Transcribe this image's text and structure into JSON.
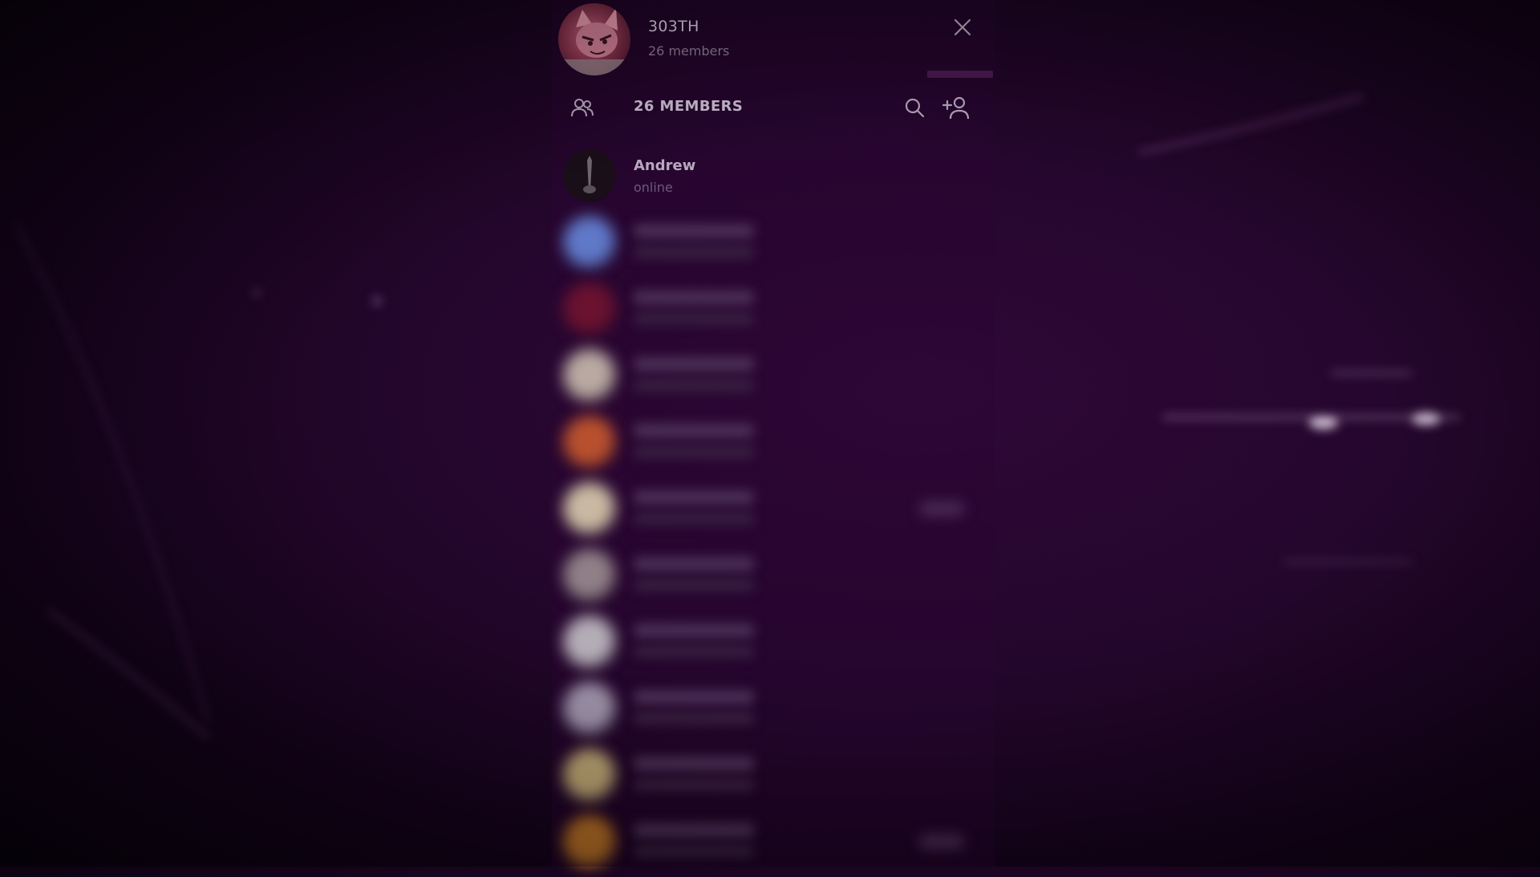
{
  "group": {
    "title": "303TH",
    "subtitle": "26 members",
    "avatar_icon": "cat-avatar"
  },
  "toolbar": {
    "members_heading": "26 MEMBERS",
    "icons": [
      "members-icon",
      "search-icon",
      "add-member-icon"
    ]
  },
  "members": [
    {
      "name": "Andrew",
      "status": "online",
      "avatar_color": "#1a0f18",
      "blurred": false
    },
    {
      "name": "",
      "status": "",
      "avatar_color": "#5f78c8",
      "blurred": true
    },
    {
      "name": "",
      "status": "",
      "avatar_color": "#6a1230",
      "blurred": true
    },
    {
      "name": "",
      "status": "",
      "avatar_color": "#b9a9a2",
      "blurred": true
    },
    {
      "name": "",
      "status": "",
      "avatar_color": "#b8502e",
      "blurred": true
    },
    {
      "name": "",
      "status": "",
      "avatar_color": "#c9b9a2",
      "blurred": true
    },
    {
      "name": "",
      "status": "",
      "avatar_color": "#8f7f86",
      "blurred": true
    },
    {
      "name": "",
      "status": "",
      "avatar_color": "#b4adb6",
      "blurred": true
    },
    {
      "name": "",
      "status": "",
      "avatar_color": "#9b8fa6",
      "blurred": true
    },
    {
      "name": "",
      "status": "",
      "avatar_color": "#b7a070",
      "blurred": true
    },
    {
      "name": "",
      "status": "",
      "avatar_color": "#b06b24",
      "blurred": true
    }
  ],
  "colors": {
    "background": "#24062c",
    "accent": "#4a1a52"
  }
}
